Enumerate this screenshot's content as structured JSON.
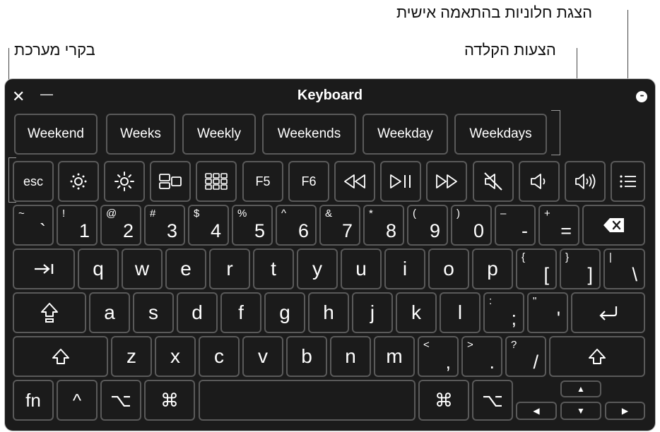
{
  "callouts": {
    "custom_panels": "הצגת חלוניות בהתאמה אישית",
    "typing_suggestions": "הצעות הקלדה",
    "system_controls": "בקרי מערכת"
  },
  "window": {
    "title": "Keyboard",
    "close_glyph": "✕",
    "minimize_glyph": "—",
    "more_glyph": "•••"
  },
  "suggestions": [
    "Weekend",
    "Weeks",
    "Weekly",
    "Weekends",
    "Weekday",
    "Weekdays"
  ],
  "function_row": {
    "esc": "esc",
    "f5": "F5",
    "f6": "F6"
  },
  "number_row": [
    {
      "sym": "~",
      "main": "`"
    },
    {
      "sym": "!",
      "main": "1"
    },
    {
      "sym": "@",
      "main": "2"
    },
    {
      "sym": "#",
      "main": "3"
    },
    {
      "sym": "$",
      "main": "4"
    },
    {
      "sym": "%",
      "main": "5"
    },
    {
      "sym": "^",
      "main": "6"
    },
    {
      "sym": "&",
      "main": "7"
    },
    {
      "sym": "*",
      "main": "8"
    },
    {
      "sym": "(",
      "main": "9"
    },
    {
      "sym": ")",
      "main": "0"
    },
    {
      "sym": "–",
      "main": "-"
    },
    {
      "sym": "+",
      "main": "="
    }
  ],
  "qwerty_row": [
    "q",
    "w",
    "e",
    "r",
    "t",
    "y",
    "u",
    "i",
    "o",
    "p"
  ],
  "qwerty_sym": [
    {
      "sym": "{",
      "main": "["
    },
    {
      "sym": "}",
      "main": "]"
    },
    {
      "sym": "|",
      "main": "\\"
    }
  ],
  "home_row": [
    "a",
    "s",
    "d",
    "f",
    "g",
    "h",
    "j",
    "k",
    "l"
  ],
  "home_sym": [
    {
      "sym": ":",
      "main": ";"
    },
    {
      "sym": "\"",
      "main": "'"
    }
  ],
  "bottom_row": [
    "z",
    "x",
    "c",
    "v",
    "b",
    "n",
    "m"
  ],
  "bottom_sym": [
    {
      "sym": "<",
      "main": ","
    },
    {
      "sym": ">",
      "main": "."
    },
    {
      "sym": "?",
      "main": "/"
    }
  ],
  "modifiers": {
    "fn": "fn",
    "control": "^",
    "option": "⌥",
    "command": "⌘"
  },
  "arrows": {
    "up": "▲",
    "down": "▼",
    "left": "◀",
    "right": "▶"
  }
}
